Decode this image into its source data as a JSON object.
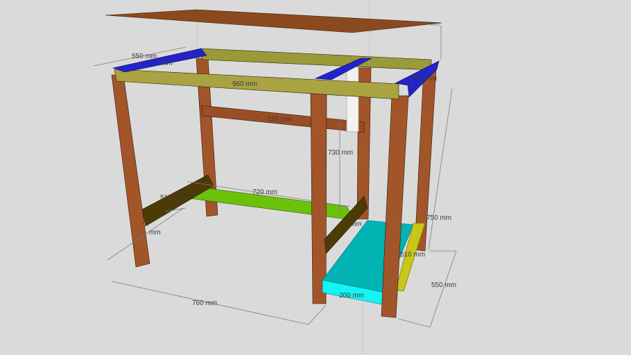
{
  "model": {
    "title": "Desk frame 3D model",
    "colors": {
      "background": "#dadada",
      "wood_leg": "#a3552a",
      "wood_leg_shade": "#6f3514",
      "top_board": "#8b4a1e",
      "blue_beam": "#2323c8",
      "olive_beam": "#9c9a38",
      "green_beam": "#6cc10a",
      "dark_cross": "#4d3b06",
      "cyan_shelf": "#02b3b3",
      "yellow_rail": "#c9c61a",
      "pipe": "#f2f2f2"
    },
    "dimensions": {
      "top_depth": "550 mm",
      "top_depth_inner": "mm",
      "front_beam": "960 mm",
      "back_rail": "720 mm",
      "pipe_height": "730 mm",
      "lower_rail": "720 mm",
      "left_cross": "510 mm",
      "left_depth": "mm",
      "mid_cross": "mm",
      "right_top": "510 mm",
      "right_height": "750 mm",
      "right_rail": "510 mm",
      "right_depth": "550 mm",
      "base_width": "760 mm",
      "shelf_width": "200 mm"
    }
  }
}
